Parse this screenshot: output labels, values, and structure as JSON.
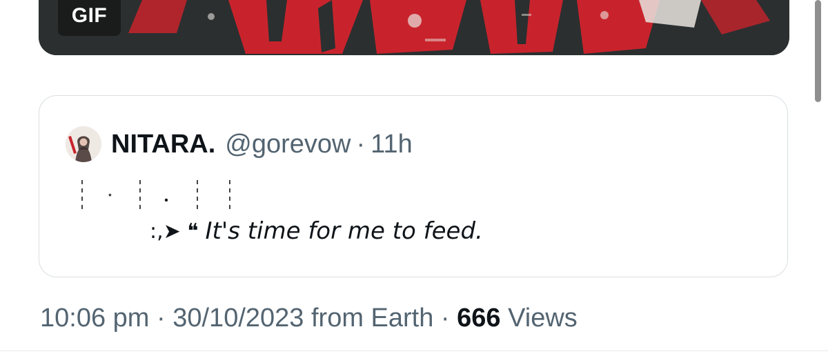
{
  "media": {
    "badge": "GIF",
    "accent": "#c8232c",
    "base": "#2b2f30"
  },
  "quoted_tweet": {
    "display_name": "NITARA.",
    "handle": "@gorevow",
    "separator": "·",
    "time": "11h",
    "decorative_line": "┆ ⋆ ┆ . ┆ ┆",
    "arrow": ":,➤ ❝",
    "text": "It's time for me to feed."
  },
  "meta": {
    "time": "10:06 pm",
    "sep1": " · ",
    "date": "30/10/2023",
    "source": " from Earth",
    "sep2": " · ",
    "views_count": "666",
    "views_label": " Views"
  },
  "colors": {
    "text_primary": "#0f1419",
    "text_secondary": "#536471",
    "border": "#d9dee2"
  }
}
